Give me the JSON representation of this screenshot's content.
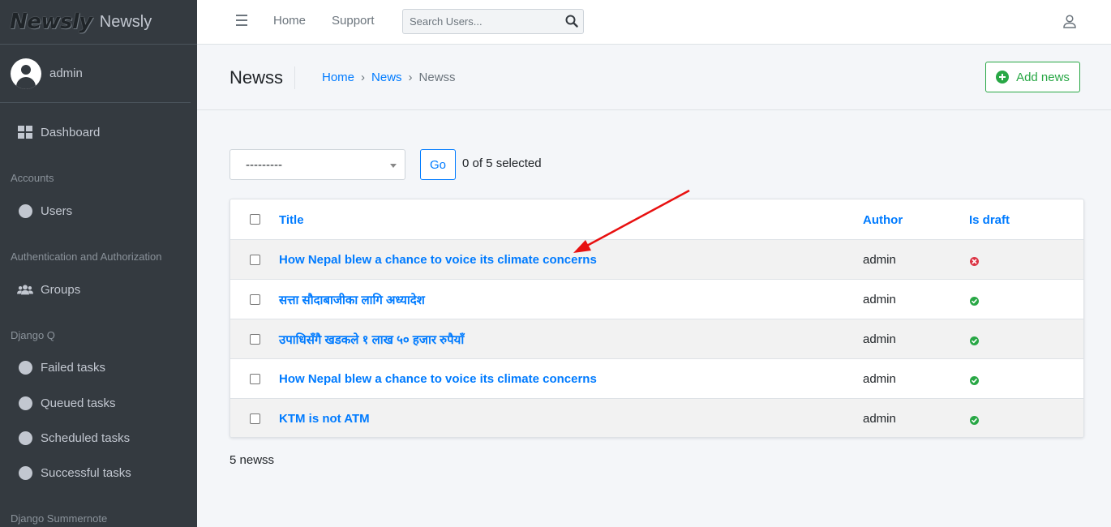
{
  "brand": {
    "logo_text": "Newsly",
    "name": "Newsly"
  },
  "user": {
    "name": "admin"
  },
  "sidebar": {
    "dashboard": "Dashboard",
    "sections": [
      {
        "header": "Accounts",
        "items": [
          "Users"
        ]
      },
      {
        "header": "Authentication and Authorization",
        "items": [
          "Groups"
        ]
      },
      {
        "header": "Django Q",
        "items": [
          "Failed tasks",
          "Queued tasks",
          "Scheduled tasks",
          "Successful tasks"
        ]
      },
      {
        "header": "Django Summernote",
        "items": []
      }
    ]
  },
  "topnav": {
    "links": [
      "Home",
      "Support"
    ],
    "search_placeholder": "Search Users..."
  },
  "header": {
    "title": "Newss",
    "breadcrumb": [
      "Home",
      "News",
      "Newss"
    ],
    "add_button": "Add news"
  },
  "actions": {
    "selected_option": "---------",
    "go_label": "Go",
    "selected_count": "0 of 5 selected"
  },
  "table": {
    "columns": [
      "Title",
      "Author",
      "Is draft"
    ],
    "rows": [
      {
        "title": "How Nepal blew a chance to voice its climate concerns",
        "author": "admin",
        "is_draft": false
      },
      {
        "title": "सत्ता सौदाबाजीका लागि अध्यादेश",
        "author": "admin",
        "is_draft": true
      },
      {
        "title": "उपाधिसँगै खडकले १ लाख ५० हजार रुपैयाँ",
        "author": "admin",
        "is_draft": true
      },
      {
        "title": "How Nepal blew a chance to voice its climate concerns",
        "author": "admin",
        "is_draft": true
      },
      {
        "title": "KTM is not ATM",
        "author": "admin",
        "is_draft": true
      }
    ]
  },
  "footer": {
    "count": "5 newss"
  },
  "colors": {
    "accent": "#007bff",
    "success": "#28a745",
    "danger": "#dc3545",
    "sidebar": "#343a40",
    "annotation_arrow": "#e81010"
  }
}
